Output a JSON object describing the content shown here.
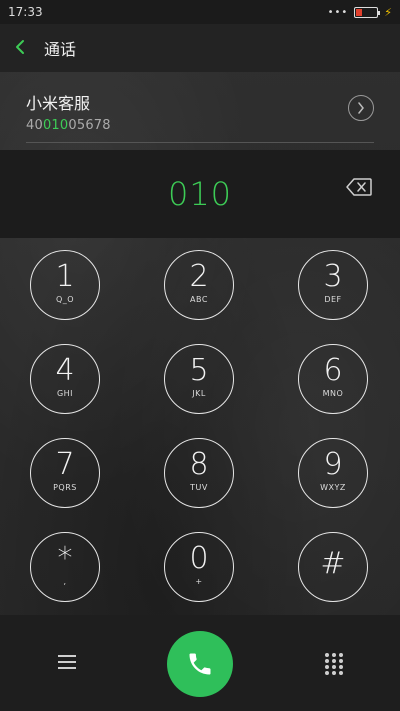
{
  "status_bar": {
    "time": "17:33",
    "signal_dots": "•••"
  },
  "header": {
    "title": "通话"
  },
  "suggestion": {
    "name": "小米客服",
    "number_pre": "40",
    "number_match": "010",
    "number_post": "05678"
  },
  "entry": {
    "number": "010"
  },
  "keypad": [
    {
      "digit": "1",
      "letters": "Q_O"
    },
    {
      "digit": "2",
      "letters": "ABC"
    },
    {
      "digit": "3",
      "letters": "DEF"
    },
    {
      "digit": "4",
      "letters": "GHI"
    },
    {
      "digit": "5",
      "letters": "JKL"
    },
    {
      "digit": "6",
      "letters": "MNO"
    },
    {
      "digit": "7",
      "letters": "PQRS"
    },
    {
      "digit": "8",
      "letters": "TUV"
    },
    {
      "digit": "9",
      "letters": "WXYZ"
    },
    {
      "digit": "*",
      "letters": ","
    },
    {
      "digit": "0",
      "letters": "+"
    },
    {
      "digit": "#",
      "letters": ""
    }
  ],
  "colors": {
    "accent": "#3dcc56",
    "call_button": "#2fbf5a"
  }
}
